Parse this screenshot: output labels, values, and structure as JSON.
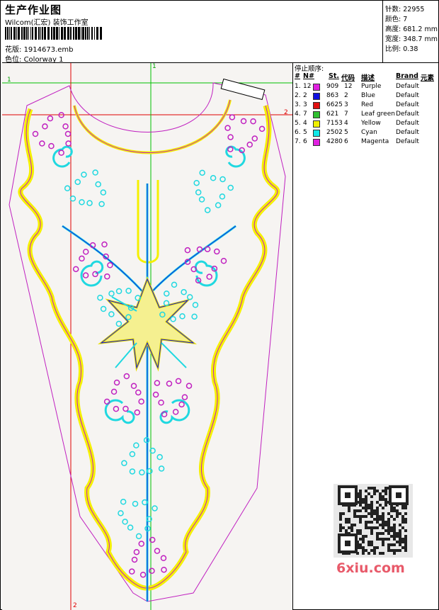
{
  "header": {
    "title": "生产作业图",
    "company": "Wilcom(汇宏) 装饰工作室",
    "design_label": "花版:",
    "design_value": "1914673.emb",
    "colorway_label": "色位:",
    "colorway_value": "Colorway 1"
  },
  "stats": {
    "stitches_label": "针数:",
    "stitches": "22955",
    "colors_label": "颜色:",
    "colors": "7",
    "height_label": "高度:",
    "height": "681.2 mm",
    "width_label": "宽度:",
    "width": "348.7 mm",
    "scale_label": "比例:",
    "scale": "0.38"
  },
  "canvas": {
    "guide_labels": [
      "1",
      "1",
      "2",
      "2"
    ]
  },
  "sequence": {
    "title": "停止顺序:",
    "headers": {
      "num": "#",
      "n": "N#",
      "st": "St.",
      "code": "代码",
      "desc": "描述",
      "brand": "Brand",
      "elem": "元素"
    },
    "rows": [
      {
        "num": "1.",
        "n": "12",
        "color": "#e020e0",
        "st": "909",
        "code": "12",
        "desc": "Purple",
        "brand": "Default"
      },
      {
        "num": "2.",
        "n": "2",
        "color": "#1010e0",
        "st": "863",
        "code": "2",
        "desc": "Blue",
        "brand": "Default"
      },
      {
        "num": "3.",
        "n": "3",
        "color": "#e01010",
        "st": "6625",
        "code": "3",
        "desc": "Red",
        "brand": "Default"
      },
      {
        "num": "4.",
        "n": "7",
        "color": "#30c030",
        "st": "621",
        "code": "7",
        "desc": "Leaf green",
        "brand": "Default"
      },
      {
        "num": "5.",
        "n": "4",
        "color": "#f0f000",
        "st": "7153",
        "code": "4",
        "desc": "Yellow",
        "brand": "Default"
      },
      {
        "num": "6.",
        "n": "5",
        "color": "#10e8e8",
        "st": "2502",
        "code": "5",
        "desc": "Cyan",
        "brand": "Default"
      },
      {
        "num": "7.",
        "n": "6",
        "color": "#e020e0",
        "st": "4280",
        "code": "6",
        "desc": "Magenta",
        "brand": "Default"
      }
    ]
  },
  "watermark": {
    "site": "6xiu.com"
  },
  "colors": {
    "purple": "#c020c0",
    "yellow": "#f5f000",
    "cyan": "#20d8e0",
    "guide_green": "#00c000",
    "guide_red": "#e00000"
  }
}
